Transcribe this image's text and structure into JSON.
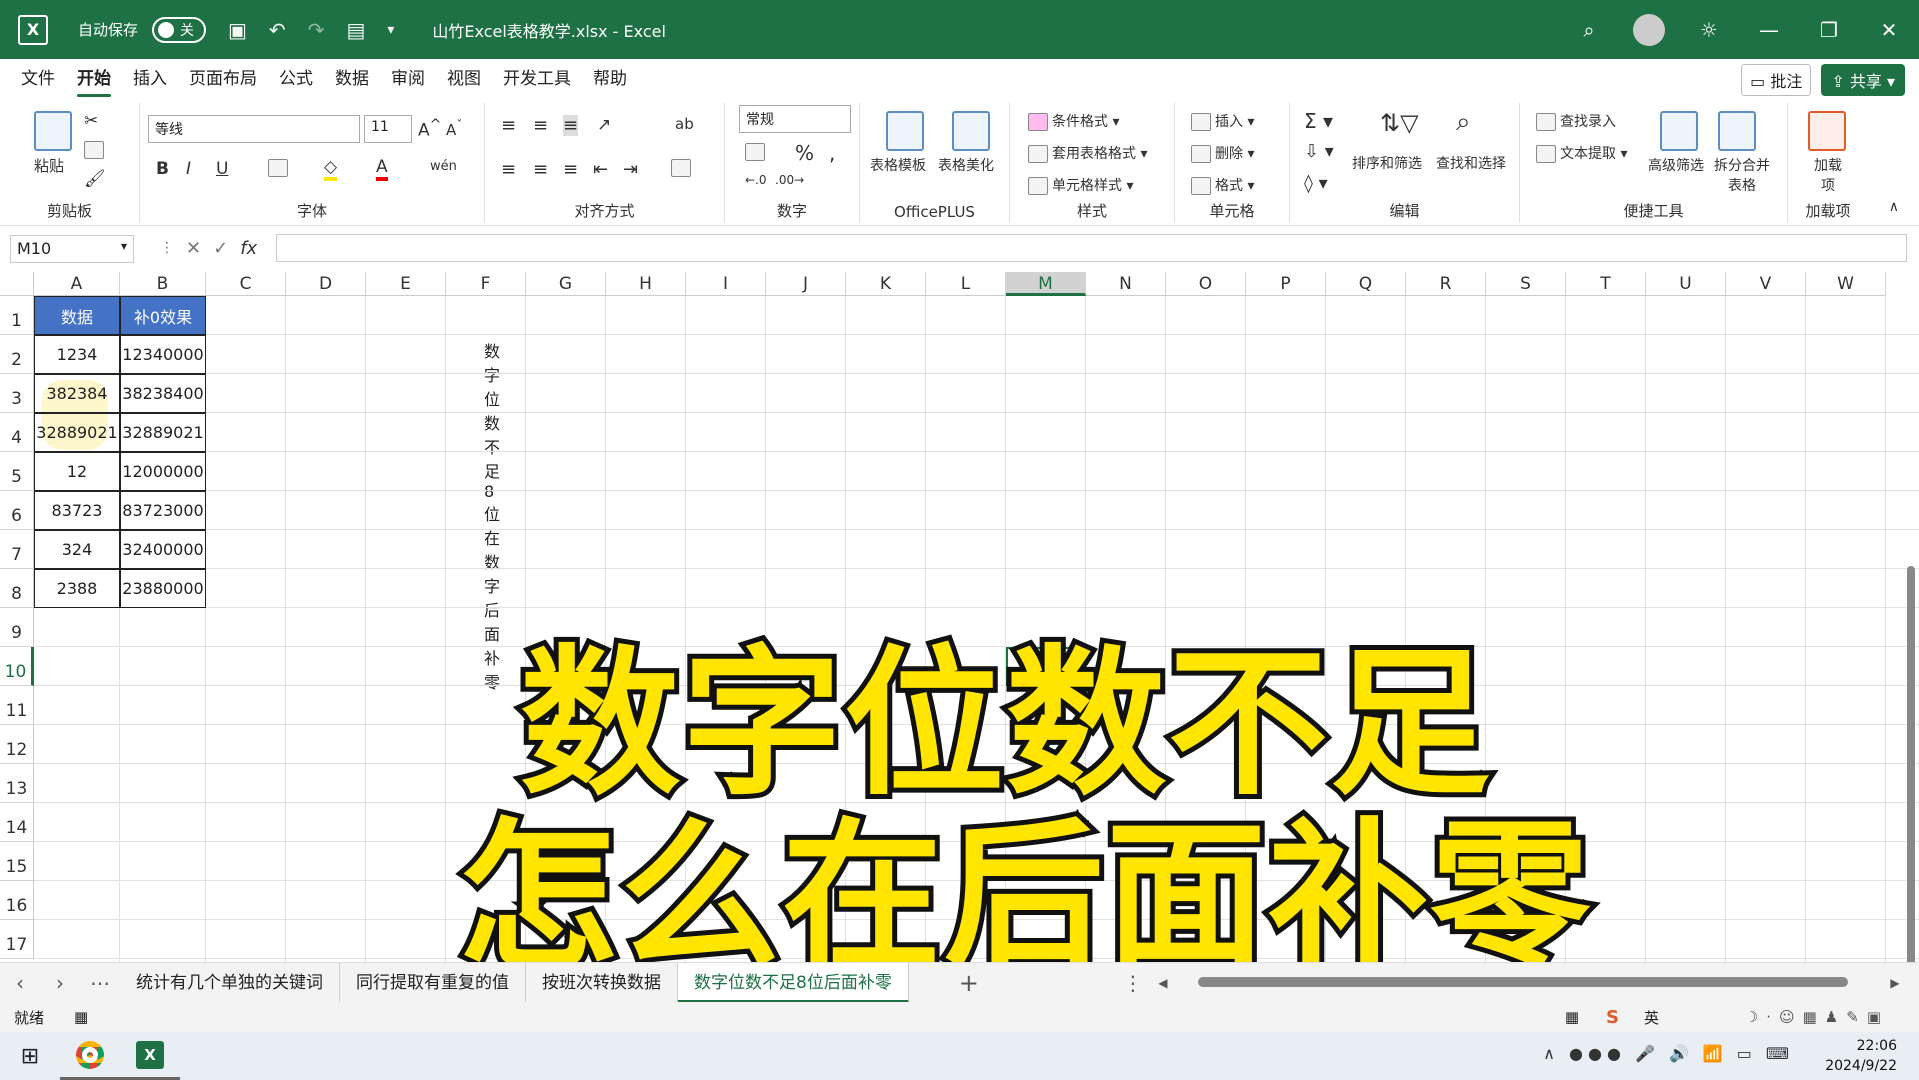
{
  "title_bar": {
    "app_icon": "X",
    "autosave_label": "自动保存",
    "autosave_state": "关",
    "doc_title": "山竹Excel表格教学.xlsx - Excel"
  },
  "menu": {
    "tabs": [
      "文件",
      "开始",
      "插入",
      "页面布局",
      "公式",
      "数据",
      "审阅",
      "视图",
      "开发工具",
      "帮助"
    ],
    "active": "开始",
    "comments_button": "批注",
    "share_button": "共享"
  },
  "ribbon": {
    "clipboard": {
      "paste": "粘贴",
      "label": "剪贴板"
    },
    "font": {
      "family": "等线",
      "size": "11",
      "label": "字体",
      "bold": "B",
      "italic": "I",
      "underline": "U"
    },
    "align": {
      "label": "对齐方式"
    },
    "number": {
      "format": "常规",
      "label": "数字",
      "percent": "%"
    },
    "officeplus": {
      "template": "表格模板",
      "beautify": "表格美化",
      "label": "OfficePLUS"
    },
    "styles": {
      "conditional": "条件格式",
      "table_format": "套用表格格式",
      "cell_style": "单元格样式",
      "label": "样式"
    },
    "cells": {
      "insert": "插入",
      "delete": "删除",
      "format": "格式",
      "label": "单元格"
    },
    "editing": {
      "sort_filter": "排序和筛选",
      "find_select": "查找和选择",
      "label": "编辑"
    },
    "tools": {
      "find_entry": "查找录入",
      "text_extract": "文本提取",
      "adv_filter": "高级筛选",
      "split_merge": "拆分合并表格",
      "label": "便捷工具"
    },
    "addins": {
      "addin": "加载项",
      "label": "加载项"
    }
  },
  "formula_bar": {
    "name_box": "M10",
    "fx": "fx",
    "formula": ""
  },
  "columns": [
    "A",
    "B",
    "C",
    "D",
    "E",
    "F",
    "G",
    "H",
    "I",
    "J",
    "K",
    "L",
    "M",
    "N",
    "O",
    "P",
    "Q",
    "R",
    "S",
    "T",
    "U",
    "V",
    "W"
  ],
  "selected_column": "M",
  "rows": [
    "1",
    "2",
    "3",
    "4",
    "5",
    "6",
    "7",
    "8",
    "9",
    "10",
    "11",
    "12",
    "13",
    "14",
    "15",
    "16",
    "17"
  ],
  "selected_row": "10",
  "table": {
    "headers": [
      "数据",
      "补0效果"
    ],
    "rows": [
      [
        "1234",
        "12340000"
      ],
      [
        "382384",
        "38238400"
      ],
      [
        "32889021",
        "32889021"
      ],
      [
        "12",
        "12000000"
      ],
      [
        "83723",
        "83723000"
      ],
      [
        "324",
        "32400000"
      ],
      [
        "2388",
        "23880000"
      ]
    ]
  },
  "note_text": "数字位数不足8位在数字后面补零",
  "overlay": {
    "line1": "数字位数不足",
    "line2": "怎么在后面补零"
  },
  "sheet_tabs": [
    "统计有几个单独的关键词",
    "同行提取有重复的值",
    "按班次转换数据",
    "数字位数不足8位后面补零"
  ],
  "active_sheet": "数字位数不足8位后面补零",
  "status": {
    "ready": "就绪"
  },
  "taskbar": {
    "ime": "英",
    "time": "22:06",
    "date": "2024/9/22"
  },
  "colors": {
    "excel_green": "#1e7145",
    "header_blue": "#4472c4",
    "overlay_yellow": "#ffe500"
  }
}
